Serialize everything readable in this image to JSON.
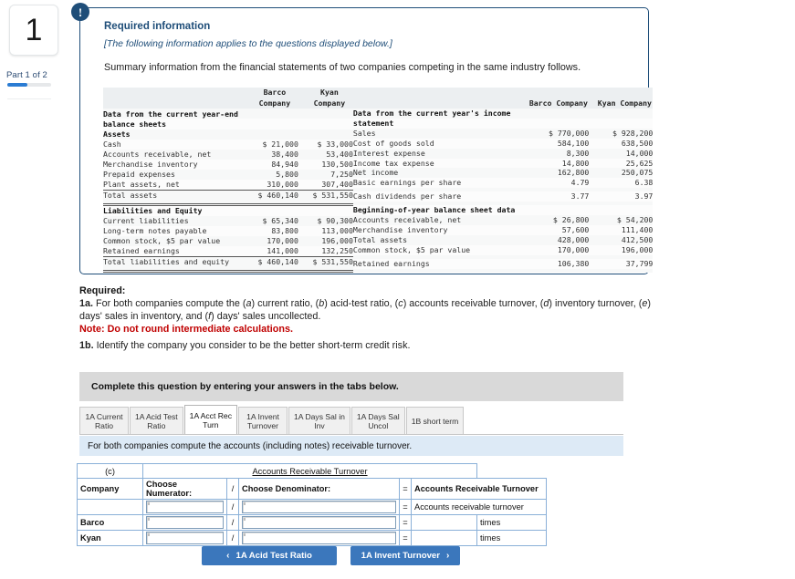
{
  "rail": {
    "question_number": "1",
    "part_label": "Part 1 of 2"
  },
  "alert": {
    "icon": "exclamation-icon",
    "glyph": "!"
  },
  "card": {
    "title": "Required information",
    "subtitle": "[The following information applies to the questions displayed below.]",
    "summary": "Summary information from the financial statements of two companies competing in the same industry follows."
  },
  "balance_table": {
    "col_headers": [
      "",
      "Barco Company",
      "Kyan Company"
    ],
    "header_line1": [
      "Barco",
      "Kyan"
    ],
    "header_line2": [
      "Company",
      "Company"
    ],
    "section1_title_line1": "Data from the current year-end",
    "section1_title_line2": "balance sheets",
    "assets_title": "Assets",
    "asset_rows": [
      {
        "label": "Cash",
        "barco": "$ 21,000",
        "kyan": "$ 33,000"
      },
      {
        "label": "Accounts receivable, net",
        "barco": "38,400",
        "kyan": "53,400"
      },
      {
        "label": "Merchandise inventory",
        "barco": "84,940",
        "kyan": "130,500"
      },
      {
        "label": "Prepaid expenses",
        "barco": "5,800",
        "kyan": "7,250"
      },
      {
        "label": "Plant assets, net",
        "barco": "310,000",
        "kyan": "307,400"
      }
    ],
    "total_assets": {
      "label": "Total assets",
      "barco": "$ 460,140",
      "kyan": "$ 531,550"
    },
    "liab_title": "Liabilities and Equity",
    "liab_rows": [
      {
        "label": "Current liabilities",
        "barco": "$ 65,340",
        "kyan": "$ 90,300"
      },
      {
        "label": "Long-term notes payable",
        "barco": "83,800",
        "kyan": "113,000"
      },
      {
        "label": "Common stock, $5 par value",
        "barco": "170,000",
        "kyan": "196,000"
      },
      {
        "label": "Retained earnings",
        "barco": "141,000",
        "kyan": "132,250"
      }
    ],
    "total_liab": {
      "label": "Total liabilities and equity",
      "barco": "$ 460,140",
      "kyan": "$ 531,550"
    }
  },
  "income_table": {
    "header_barco": "Barco Company",
    "header_kyan": "Kyan Company",
    "section1_title_line1": "Data from the current year's income",
    "section1_title_line2": "statement",
    "income_rows": [
      {
        "label": "Sales",
        "barco": "$ 770,000",
        "kyan": "$ 928,200"
      },
      {
        "label": "Cost of goods sold",
        "barco": "584,100",
        "kyan": "638,500"
      },
      {
        "label": "Interest expense",
        "barco": "8,300",
        "kyan": "14,000"
      },
      {
        "label": "Income tax expense",
        "barco": "14,800",
        "kyan": "25,625"
      },
      {
        "label": "Net income",
        "barco": "162,800",
        "kyan": "250,075"
      },
      {
        "label": "Basic earnings per share",
        "barco": "4.79",
        "kyan": "6.38"
      }
    ],
    "cash_div": {
      "label": "Cash dividends per share",
      "barco": "3.77",
      "kyan": "3.97"
    },
    "section2_title": "Beginning-of-year balance sheet data",
    "begin_rows": [
      {
        "label": "Accounts receivable, net",
        "barco": "$ 26,800",
        "kyan": "$ 54,200"
      },
      {
        "label": "Merchandise inventory",
        "barco": "57,600",
        "kyan": "111,400"
      },
      {
        "label": "Total assets",
        "barco": "428,000",
        "kyan": "412,500"
      },
      {
        "label": "Common stock, $5 par value",
        "barco": "170,000",
        "kyan": "196,000"
      }
    ],
    "retained": {
      "label": "Retained earnings",
      "barco": "106,380",
      "kyan": "37,799"
    }
  },
  "required": {
    "heading": "Required:",
    "item_1a_prefix": "1a.",
    "line1_part1": " For both companies compute the (",
    "line1_a": "a",
    "line1_part2": ") current ratio, (",
    "line1_b": "b",
    "line1_part3": ") acid-test ratio, (",
    "line1_c": "c",
    "line1_part4": ") accounts receivable turnover, (",
    "line1_d": "d",
    "line1_part5": ") inventory turnover, (",
    "line1_e": "e",
    "line1_part6": ") days'",
    "line2_part1": "sales in inventory, and (",
    "line2_f": "f",
    "line2_part2": ") days' sales uncollected.",
    "note": "Note: Do not round intermediate calculations.",
    "item_1b_prefix": "1b.",
    "item_1b_text": " Identify the company you consider to be the better short-term credit risk."
  },
  "complete_banner": "Complete this question by entering your answers in the tabs below.",
  "tabs": [
    {
      "line1": "1A Current",
      "line2": "Ratio",
      "active": false
    },
    {
      "line1": "1A Acid Test",
      "line2": "Ratio",
      "active": false
    },
    {
      "line1": "1A Acct Rec",
      "line2": "Turn",
      "active": true
    },
    {
      "line1": "1A Invent",
      "line2": "Turnover",
      "active": false
    },
    {
      "line1": "1A Days Sal in",
      "line2": "Inv",
      "active": false
    },
    {
      "line1": "1A Days Sal",
      "line2": "Uncol",
      "active": false
    },
    {
      "line1": "1B short term",
      "line2": "",
      "active": false
    }
  ],
  "tab_description": "For both companies compute the accounts (including notes) receivable turnover.",
  "answer_table": {
    "part_label": "(c)",
    "title": "Accounts Receivable Turnover",
    "col_company": "Company",
    "col_numerator": "Choose Numerator:",
    "col_slash": "/",
    "col_denominator": "Choose Denominator:",
    "col_equals": "=",
    "col_result": "Accounts Receivable Turnover",
    "result_row_label": "Accounts receivable turnover",
    "rows": [
      {
        "company": "",
        "numerator": "",
        "denominator": "",
        "result": "",
        "unit": ""
      },
      {
        "company": "Barco",
        "numerator": "",
        "denominator": "",
        "result": "",
        "unit": "times"
      },
      {
        "company": "Kyan",
        "numerator": "",
        "denominator": "",
        "result": "",
        "unit": "times"
      }
    ]
  },
  "footer": {
    "prev_label": "1A Acid Test Ratio",
    "next_label": "1A Invent Turnover",
    "prev_icon": "chevron-left-icon",
    "next_icon": "chevron-right-icon",
    "prev_chevron": "‹",
    "next_chevron": "›"
  },
  "colors": {
    "card_border": "#1f4e79",
    "accent_blue": "#3b77bc",
    "note_red": "#c00000",
    "table_blue": "#80aedd",
    "banner_gray": "#d9d9d9",
    "tabdesc_blue": "#ddeaf6"
  }
}
